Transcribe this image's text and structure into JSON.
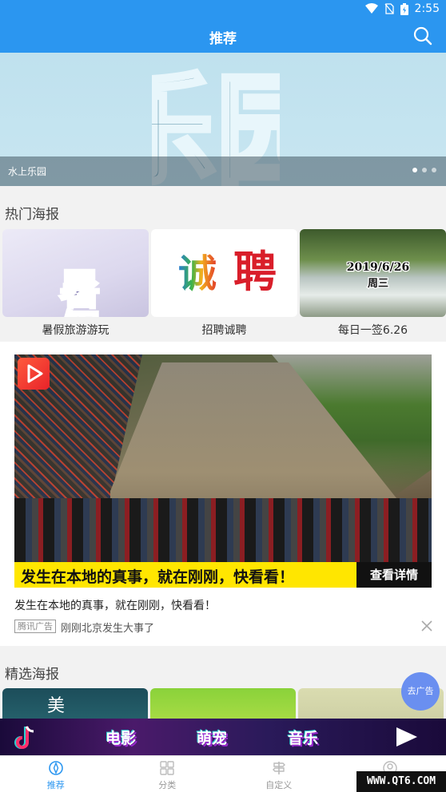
{
  "status_bar": {
    "time": "2:55"
  },
  "header": {
    "title": "推荐"
  },
  "banner": {
    "caption": "水上乐园",
    "art_text": "乐园",
    "active_slide": 1,
    "slide_count": 3
  },
  "hot_posters": {
    "title": "热门海报",
    "items": [
      {
        "label": "暑假旅游游玩",
        "art_text": "暑假"
      },
      {
        "label": "招聘诚聘",
        "art_text_1": "诚",
        "art_text_2": "聘"
      },
      {
        "label": "每日一签6.26",
        "art_date": "2019/6/26",
        "art_weekday": "周三"
      }
    ]
  },
  "ad": {
    "banner_text": "发生在本地的真事，就在刚刚，快看看！",
    "cta": "查看详情",
    "description": "发生在本地的真事，就在刚刚，快看看！",
    "tag": "腾讯广告",
    "source": "刚刚北京发生大事了"
  },
  "featured_posters": {
    "title": "精选海报",
    "first_art_text": "美"
  },
  "float_ad": {
    "label": "去广告"
  },
  "bottom_ad": {
    "items": [
      "电影",
      "萌宠",
      "音乐"
    ]
  },
  "tabs": [
    {
      "label": "推荐",
      "active": true
    },
    {
      "label": "分类",
      "active": false
    },
    {
      "label": "自定义",
      "active": false
    },
    {
      "label": "我的",
      "active": false
    }
  ],
  "watermark": "WWW.QT6.COM",
  "colors": {
    "brand_blue": "#2b96f0",
    "ad_yellow": "#ffe600"
  }
}
